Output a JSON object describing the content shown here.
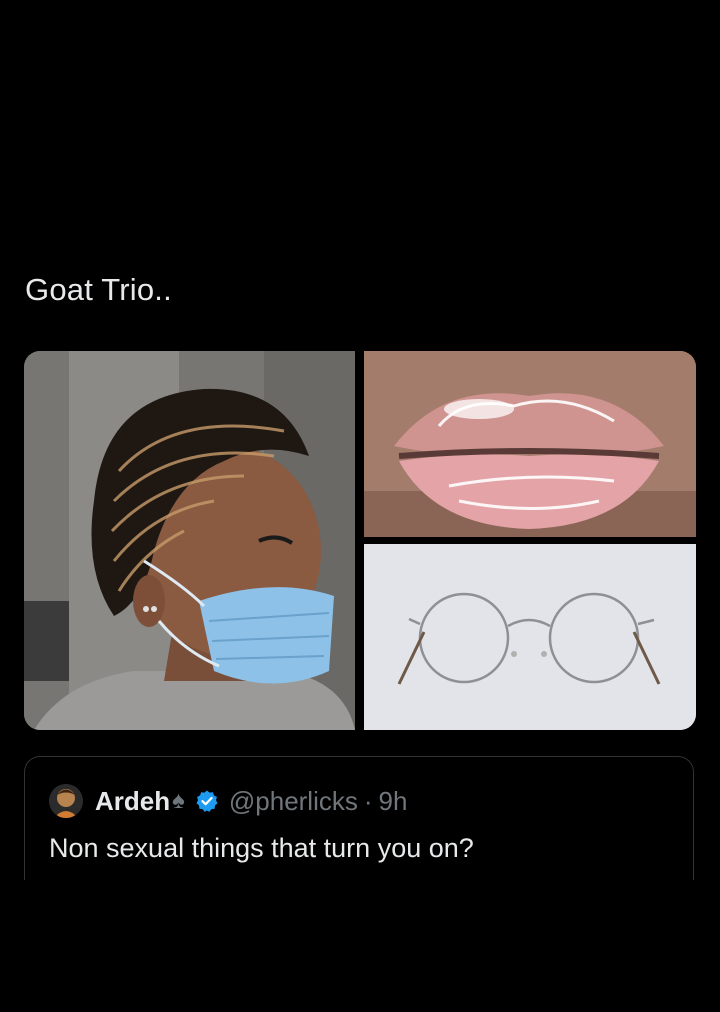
{
  "tweet": {
    "text": "Goat Trio.."
  },
  "media": [
    {
      "icon": "braided-hair-masked-person-image"
    },
    {
      "icon": "glossy-lips-image"
    },
    {
      "icon": "round-eyeglasses-image"
    }
  ],
  "quoted_tweet": {
    "display_name": "Ardeh",
    "name_emoji": "♠",
    "verified": true,
    "handle": "@pherlicks",
    "separator": "·",
    "timestamp": "9h",
    "text": "Non sexual things that turn you on?"
  },
  "colors": {
    "background": "#000000",
    "text_primary": "#e7e9ea",
    "text_secondary": "#71767b",
    "border": "#2f3336",
    "verified_blue": "#1d9bf0"
  }
}
